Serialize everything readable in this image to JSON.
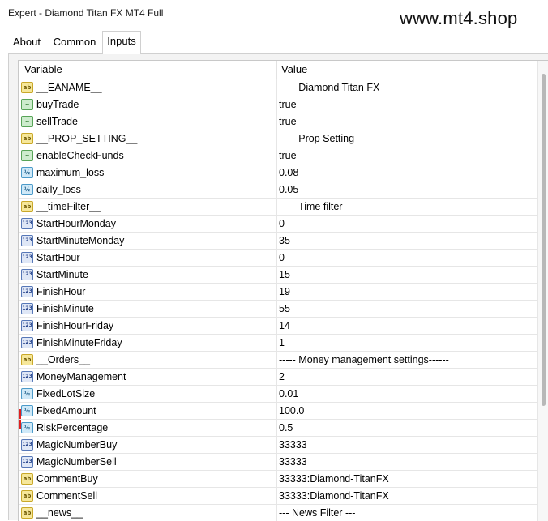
{
  "window": {
    "title": "Expert - Diamond Titan FX MT4 Full"
  },
  "watermark": "www.mt4.shop",
  "tabs": [
    {
      "label": "About"
    },
    {
      "label": "Common"
    },
    {
      "label": "Inputs"
    }
  ],
  "active_tab": "Inputs",
  "table": {
    "columns": [
      "Variable",
      "Value"
    ],
    "rows": [
      {
        "icon": "ab-string-icon",
        "type": "ab",
        "name": "__EANAME__",
        "value": "----- Diamond Titan FX ------"
      },
      {
        "icon": "bool-icon",
        "type": "bool",
        "name": "buyTrade",
        "value": "true"
      },
      {
        "icon": "bool-icon",
        "type": "bool",
        "name": "sellTrade",
        "value": "true"
      },
      {
        "icon": "ab-string-icon",
        "type": "ab",
        "name": "__PROP_SETTING__",
        "value": "----- Prop Setting ------"
      },
      {
        "icon": "bool-icon",
        "type": "bool",
        "name": "enableCheckFunds",
        "value": "true"
      },
      {
        "icon": "double-icon",
        "type": "dbl",
        "name": "maximum_loss",
        "value": "0.08"
      },
      {
        "icon": "double-icon",
        "type": "dbl",
        "name": "daily_loss",
        "value": "0.05"
      },
      {
        "icon": "ab-string-icon",
        "type": "ab",
        "name": "__timeFilter__",
        "value": "----- Time filter ------"
      },
      {
        "icon": "int-icon",
        "type": "int",
        "name": "StartHourMonday",
        "value": "0"
      },
      {
        "icon": "int-icon",
        "type": "int",
        "name": "StartMinuteMonday",
        "value": "35"
      },
      {
        "icon": "int-icon",
        "type": "int",
        "name": "StartHour",
        "value": "0"
      },
      {
        "icon": "int-icon",
        "type": "int",
        "name": "StartMinute",
        "value": "15"
      },
      {
        "icon": "int-icon",
        "type": "int",
        "name": "FinishHour",
        "value": "19"
      },
      {
        "icon": "int-icon",
        "type": "int",
        "name": "FinishMinute",
        "value": "55"
      },
      {
        "icon": "int-icon",
        "type": "int",
        "name": "FinishHourFriday",
        "value": "14"
      },
      {
        "icon": "int-icon",
        "type": "int",
        "name": "FinishMinuteFriday",
        "value": "1"
      },
      {
        "icon": "ab-string-icon",
        "type": "ab",
        "name": "__Orders__",
        "value": "----- Money management settings------"
      },
      {
        "icon": "int-icon",
        "type": "int",
        "name": "MoneyManagement",
        "value": "2"
      },
      {
        "icon": "double-icon",
        "type": "dbl",
        "name": "FixedLotSize",
        "value": "0.01"
      },
      {
        "icon": "double-icon",
        "type": "dbl",
        "name": "FixedAmount",
        "value": "100.0"
      },
      {
        "icon": "double-icon",
        "type": "dbl",
        "name": "RiskPercentage",
        "value": "0.5"
      },
      {
        "icon": "int-icon",
        "type": "int",
        "name": "MagicNumberBuy",
        "value": "33333"
      },
      {
        "icon": "int-icon",
        "type": "int",
        "name": "MagicNumberSell",
        "value": "33333"
      },
      {
        "icon": "ab-string-icon",
        "type": "ab",
        "name": "CommentBuy",
        "value": "33333:Diamond-TitanFX"
      },
      {
        "icon": "ab-string-icon",
        "type": "ab",
        "name": "CommentSell",
        "value": "33333:Diamond-TitanFX"
      },
      {
        "icon": "ab-string-icon",
        "type": "ab",
        "name": "__news__",
        "value": "--- News Filter ---"
      }
    ]
  },
  "colors": {
    "string_icon": "#f6e79a",
    "bool_icon": "#cdeccd",
    "double_icon": "#cfe9f8",
    "int_icon": "#dfe7f6",
    "left_marker": "#e02020"
  }
}
